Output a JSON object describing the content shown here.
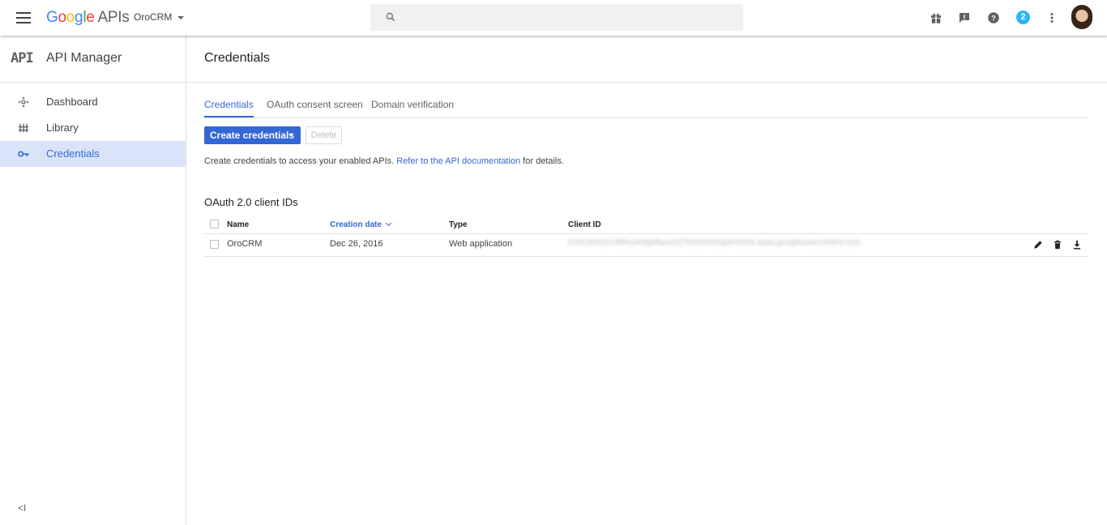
{
  "topbar": {
    "brand_letters": [
      "G",
      "o",
      "o",
      "g",
      "l",
      "e"
    ],
    "brand_suffix": "APIs",
    "project": "OroCRM",
    "search": {
      "placeholder": "",
      "value": ""
    },
    "notification_count": "2",
    "icons": [
      "menu-icon",
      "search-icon",
      "gift-icon",
      "feedback-icon",
      "help-icon",
      "notifications-badge",
      "more-vert-icon",
      "avatar"
    ]
  },
  "sidebar": {
    "badge": "API",
    "title": "API Manager",
    "items": [
      {
        "label": "Dashboard",
        "icon": "dashboard-icon",
        "active": false
      },
      {
        "label": "Library",
        "icon": "library-icon",
        "active": false
      },
      {
        "label": "Credentials",
        "icon": "key-icon",
        "active": true
      }
    ],
    "collapse": "<I"
  },
  "main": {
    "title": "Credentials",
    "tabs": [
      "Credentials",
      "OAuth consent screen",
      "Domain verification"
    ],
    "create_button": "Create credentials",
    "delete_button": "Delete",
    "description": {
      "before": "Create credentials to access your enabled APIs. ",
      "link": "Refer to the API documentation",
      "after": " for details."
    },
    "section_title": "OAuth 2.0 client IDs",
    "table": {
      "columns": [
        "Name",
        "Creation date",
        "Type",
        "Client ID"
      ],
      "rows": [
        {
          "name": "OroCRM",
          "date": "Dec 26, 2016",
          "type": "Web application",
          "client_id": "619138402149fnuxk9g6l5pum27h2hmt5s0g6n4ihhk.apps.googleusercontent.com"
        }
      ]
    }
  },
  "colors": {
    "accent": "#3367d6",
    "active_nav_bg": "#dae4f9",
    "badge": "#29b6f6"
  }
}
